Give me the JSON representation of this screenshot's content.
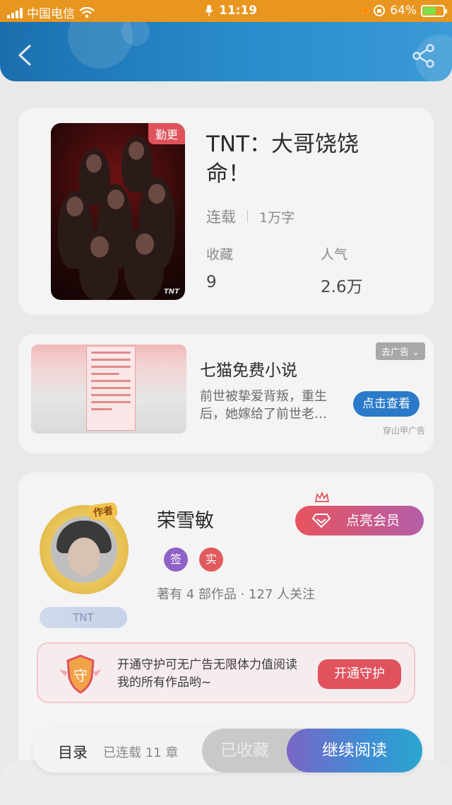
{
  "status_bar": {
    "carrier": "中国电信",
    "time": "11:19",
    "battery": "64%",
    "battery_level": 0.64
  },
  "header": {
    "back_icon": "chevron-left-icon",
    "share_icon": "share-icon"
  },
  "book": {
    "update_badge": "勤更",
    "title": "TNT：大哥饶饶命！",
    "status": "连载",
    "word_count": "1万字",
    "stats": [
      {
        "label": "收藏",
        "value": "9"
      },
      {
        "label": "人气",
        "value": "2.6万"
      }
    ]
  },
  "ad": {
    "remove_tag": "去广告",
    "title": "七猫免费小说",
    "description": "前世被挚爱背叛，重生后，她嫁给了前世老…",
    "button": "点击查看",
    "source": "穿山甲广告"
  },
  "author": {
    "avatar_tag": "作者",
    "fan_tag": "TNT",
    "name": "荣雪敏",
    "vip_button": "点亮会员",
    "badges": [
      {
        "text": "签",
        "color": "#8e62c8"
      },
      {
        "text": "实",
        "color": "#e05a5e"
      }
    ],
    "stats": "著有 4 部作品 · 127 人关注",
    "guard": {
      "shield_text": "守",
      "text": "开通守护可无广告无限体力值阅读我的所有作品哟~",
      "button": "开通守护"
    }
  },
  "bottom_bar": {
    "toc": "目录",
    "chapters": "已连载 11 章",
    "collected": "已收藏",
    "continue": "继续阅读"
  },
  "colors": {
    "header_blue": "#2a8ccc",
    "status_orange": "#e8961f",
    "accent_red": "#e0535e",
    "ad_button_blue": "#2a7ac9"
  }
}
